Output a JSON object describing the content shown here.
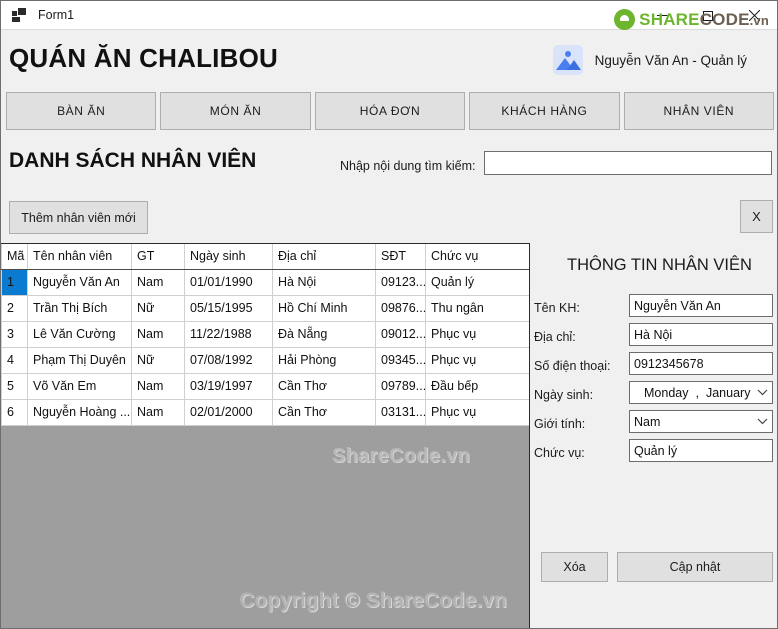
{
  "window": {
    "title": "Form1",
    "icon": "form-icon",
    "controls": {
      "minimize": "minimize-icon",
      "maximize": "maximize-icon",
      "close": "close-icon"
    }
  },
  "watermark": {
    "logo_share": "SHARE",
    "logo_code": "CODE",
    "logo_vn": ".vn",
    "middle": "ShareCode.vn",
    "bottom": "Copyright © ShareCode.vn"
  },
  "header": {
    "brand_title": "QUÁN ĂN CHALIBOU",
    "user_name": "Nguyễn Văn An - Quản lý",
    "avatar_icon": "user-avatar-image-icon"
  },
  "nav": {
    "items": [
      {
        "label": "BÀN ĂN",
        "name": "tab-ban-an"
      },
      {
        "label": "MÓN ĂN",
        "name": "tab-mon-an"
      },
      {
        "label": "HÓA ĐƠN",
        "name": "tab-hoa-don"
      },
      {
        "label": "KHÁCH HÀNG",
        "name": "tab-khach-hang"
      },
      {
        "label": "NHÂN VIÊN",
        "name": "tab-nhan-vien"
      }
    ]
  },
  "list_section": {
    "title": "DANH SÁCH NHÂN VIÊN",
    "search_label": "Nhập nội dung tìm kiếm:",
    "search_value": "",
    "search_placeholder": "",
    "add_button": "Thêm nhân viên mới",
    "close_button": "X"
  },
  "table": {
    "columns": [
      "Mã",
      "Tên nhân viên",
      "GT",
      "Ngày sinh",
      "Địa chỉ",
      "SĐT",
      "Chức vụ"
    ],
    "rows": [
      {
        "ma": "1",
        "ten": "Nguyễn Văn An",
        "gt": "Nam",
        "ngaysinh": "01/01/1990",
        "diachi": "Hà Nội",
        "sdt": "09123...",
        "chucvu": "Quản lý",
        "selected": true
      },
      {
        "ma": "2",
        "ten": "Trần Thị Bích",
        "gt": "Nữ",
        "ngaysinh": "05/15/1995",
        "diachi": "Hồ Chí Minh",
        "sdt": "09876...",
        "chucvu": "Thu ngân",
        "selected": false
      },
      {
        "ma": "3",
        "ten": "Lê Văn Cường",
        "gt": "Nam",
        "ngaysinh": "11/22/1988",
        "diachi": "Đà Nẵng",
        "sdt": "09012...",
        "chucvu": "Phục vụ",
        "selected": false
      },
      {
        "ma": "4",
        "ten": "Phạm Thị Duyên",
        "gt": "Nữ",
        "ngaysinh": "07/08/1992",
        "diachi": "Hải Phòng",
        "sdt": "09345...",
        "chucvu": "Phục vụ",
        "selected": false
      },
      {
        "ma": "5",
        "ten": "Võ Văn Em",
        "gt": "Nam",
        "ngaysinh": "03/19/1997",
        "diachi": "Cần Thơ",
        "sdt": "09789...",
        "chucvu": "Đầu bếp",
        "selected": false
      },
      {
        "ma": "6",
        "ten": "Nguyễn Hoàng ...",
        "gt": "Nam",
        "ngaysinh": "02/01/2000",
        "diachi": "Cần Thơ",
        "sdt": "03131...",
        "chucvu": "Phục vụ",
        "selected": false
      }
    ]
  },
  "detail": {
    "title": "THÔNG TIN NHÂN VIÊN",
    "fields": {
      "name_label": "Tên KH:",
      "name_value": "Nguyễn Văn An",
      "address_label": "Địa chỉ:",
      "address_value": "Hà Nội",
      "phone_label": "Số điện thoại:",
      "phone_value": "0912345678",
      "dob_label": "Ngày sinh:",
      "dob_day": "Monday",
      "dob_sep": ",",
      "dob_month": "January",
      "gender_label": "Giới tính:",
      "gender_value": "Nam",
      "role_label": "Chức vụ:",
      "role_value": "Quản lý"
    },
    "buttons": {
      "delete": "Xóa",
      "update": "Cập nhật"
    }
  },
  "colors": {
    "accent_selection": "#0b7ad1",
    "button_face": "#e0e0e0",
    "window_face": "#f0f0f0",
    "grid_empty": "#9e9e9e",
    "logo_green": "#6cb52d",
    "avatar_blue": "#4a7ff0"
  }
}
